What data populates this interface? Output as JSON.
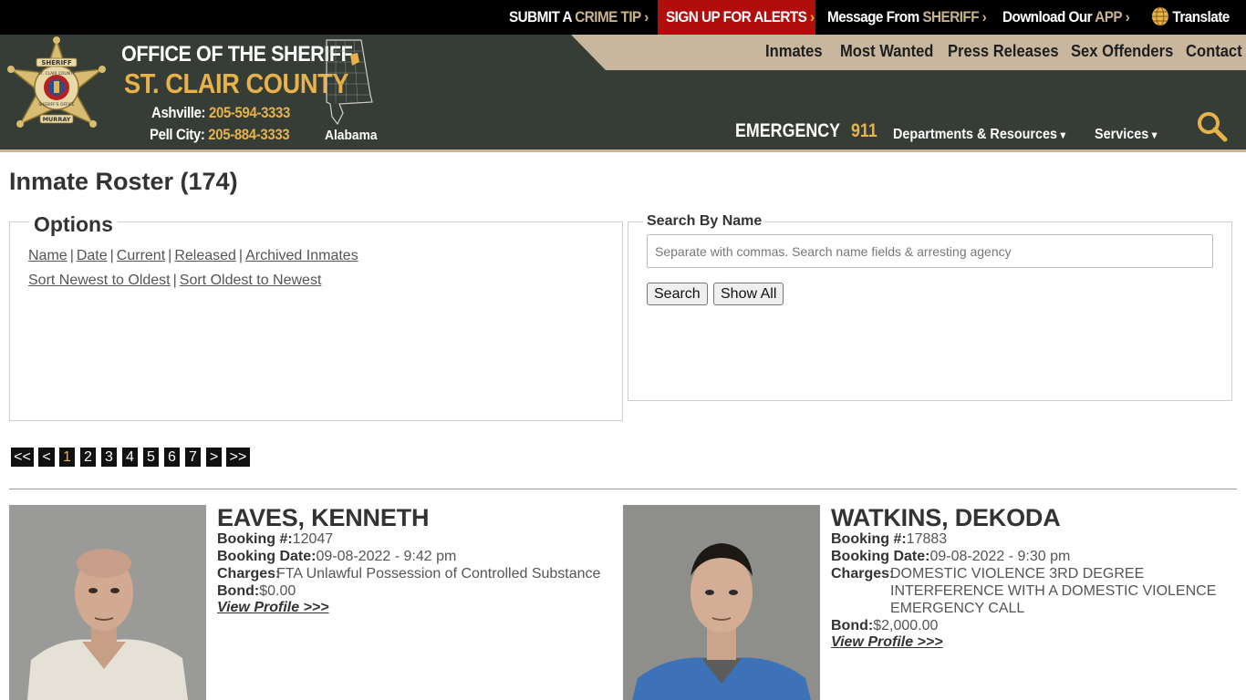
{
  "topbar": {
    "crime_tip": {
      "pre": "SUBMIT A ",
      "hl": "CRIME TIP",
      "chev": "›"
    },
    "alerts": {
      "label": "SIGN UP FOR ALERTS",
      "chev": "›"
    },
    "message": {
      "pre": "Message From ",
      "hl": "SHERIFF",
      "chev": "›"
    },
    "download": {
      "pre": "Download Our ",
      "hl": "APP",
      "chev": "›"
    },
    "translate": "Translate"
  },
  "header": {
    "title_line1": "OFFICE OF THE SHERIFF",
    "title_line2": "ST. CLAIR COUNTY",
    "badge_text": [
      "SHERIFF",
      "ST. CLAIR COUNTY",
      "SHERIFF'S OFFICE",
      "MURRAY"
    ],
    "phones": [
      {
        "label": "Ashville: ",
        "number": "205-594-3333"
      },
      {
        "label": "Pell City: ",
        "number": "205-884-3333"
      }
    ],
    "map_label": "Alabama",
    "emergency_label": "EMERGENCY",
    "emergency_number": "911",
    "nav": [
      "Inmates",
      "Most Wanted",
      "Press Releases",
      "Sex Offenders",
      "Contact"
    ],
    "dropdowns": [
      "Departments & Resources",
      "Services"
    ],
    "caret": "▾"
  },
  "colors": {
    "gold": "#e8b24a",
    "tan": "#c8b79e",
    "header_bg": "#363c36",
    "alert_red": "#b20d0d"
  },
  "page_title": "Inmate Roster (174)",
  "options": {
    "legend": "Options",
    "filters": [
      "Name",
      "Date",
      "Current",
      "Released",
      "Archived Inmates"
    ],
    "sorts": [
      "Sort Newest to Oldest",
      "Sort Oldest to Newest"
    ],
    "separator": "|"
  },
  "search": {
    "legend": "Search By Name",
    "placeholder": "Separate with commas. Search name fields & arresting agency",
    "value": "",
    "search_button": "Search",
    "show_all_button": "Show All"
  },
  "pager": {
    "first": "<<",
    "prev": "<",
    "pages": [
      "1",
      "2",
      "3",
      "4",
      "5",
      "6",
      "7"
    ],
    "current": "1",
    "next": ">",
    "last": ">>"
  },
  "inmates": [
    {
      "name": "EAVES, KENNETH",
      "booking_label": "Booking #:",
      "booking": "12047",
      "date_label": "Booking Date:",
      "date": "09-08-2022 - 9:42 pm",
      "charges_label": "Charges:",
      "charges": [
        "FTA Unlawful Possession of Controlled Substance"
      ],
      "bond_label": "Bond:",
      "bond": "$0.00",
      "link": "View Profile >>>"
    },
    {
      "name": "WATKINS, DEKODA",
      "booking_label": "Booking #:",
      "booking": "17883",
      "date_label": "Booking Date:",
      "date": "09-08-2022 - 9:30 pm",
      "charges_label": "Charges:",
      "charges": [
        "DOMESTIC VIOLENCE 3RD DEGREE",
        "INTERFERENCE WITH A DOMESTIC VIOLENCE",
        "EMERGENCY CALL"
      ],
      "bond_label": "Bond:",
      "bond": "$2,000.00",
      "link": "View Profile >>>"
    }
  ]
}
